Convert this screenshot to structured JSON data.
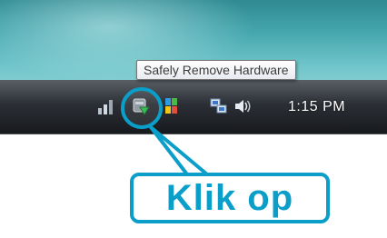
{
  "taskbar": {
    "tooltip": "Safely Remove Hardware",
    "clock": "1:15 PM",
    "icons": [
      "network-signal-icon",
      "safely-remove-hardware-icon",
      "windows-flag-icon",
      "network-connection-icon",
      "volume-icon"
    ]
  },
  "callout": {
    "label": "Klik op"
  },
  "colors": {
    "highlight": "#0a9ec9",
    "taskbar": "#1f2227",
    "wallpaper": "#46a7af"
  }
}
